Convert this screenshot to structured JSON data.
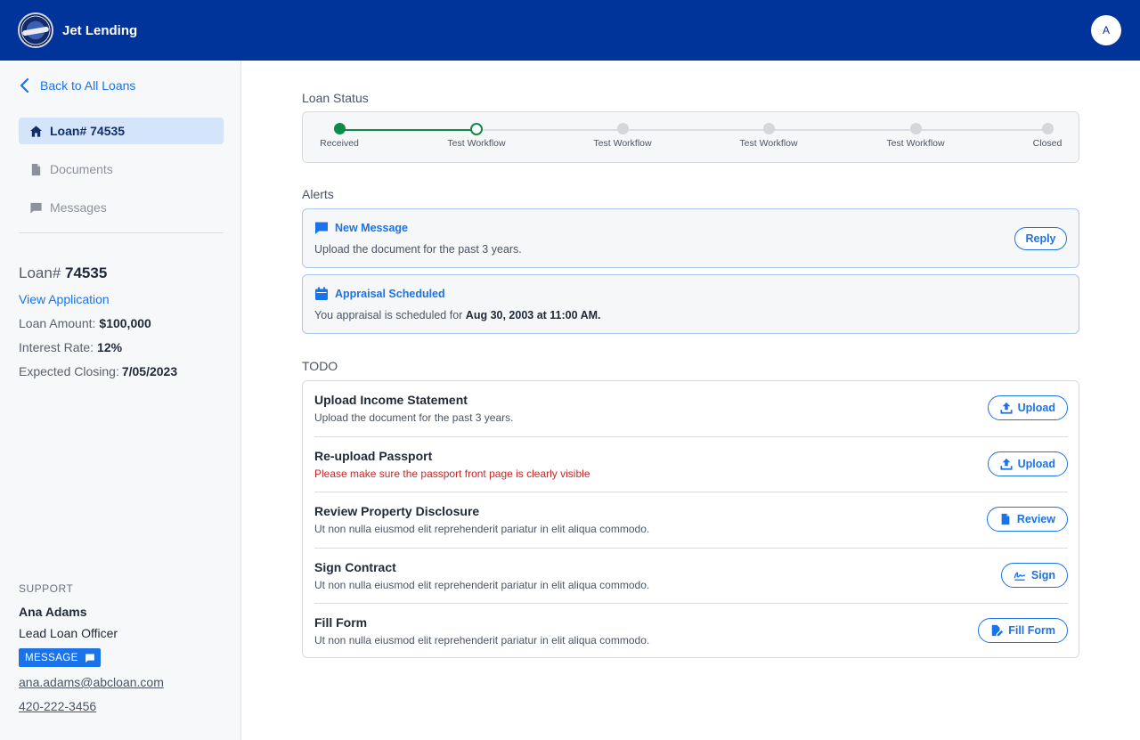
{
  "header": {
    "brand": "Jet Lending",
    "avatar_initial": "A"
  },
  "sidebar": {
    "back_label": "Back to All Loans",
    "nav": [
      {
        "label": "Loan# 74535",
        "icon": "home-icon",
        "active": true
      },
      {
        "label": "Documents",
        "icon": "document-icon",
        "active": false
      },
      {
        "label": "Messages",
        "icon": "chat-icon",
        "active": false
      }
    ],
    "loan": {
      "prefix": "Loan#",
      "number": "74535",
      "view_application": "View Application",
      "amount_label": "Loan Amount:",
      "amount": "$100,000",
      "rate_label": "Interest Rate:",
      "rate": "12%",
      "closing_label": "Expected Closing:",
      "closing": "7/05/2023"
    },
    "support": {
      "label": "SUPPORT",
      "name": "Ana Adams",
      "title": "Lead Loan Officer",
      "message_button": "MESSAGE",
      "email": "ana.adams@abcloan.com",
      "phone": "420-222-3456"
    }
  },
  "loan_status": {
    "title": "Loan Status",
    "steps": [
      {
        "label": "Received",
        "state": "done"
      },
      {
        "label": "Test Workflow",
        "state": "current"
      },
      {
        "label": "Test Workflow",
        "state": "pending"
      },
      {
        "label": "Test Workflow",
        "state": "pending"
      },
      {
        "label": "Test Workflow",
        "state": "pending"
      },
      {
        "label": "Closed",
        "state": "pending"
      }
    ],
    "colors": {
      "done": "#0e8b47",
      "pending": "#d5d7da"
    }
  },
  "alerts": {
    "title": "Alerts",
    "items": [
      {
        "icon": "chat-icon",
        "title": "New Message",
        "body": "Upload the document for the past 3 years.",
        "button": "Reply"
      },
      {
        "icon": "calendar-icon",
        "title": "Appraisal Scheduled",
        "body_prefix": "You appraisal is scheduled for ",
        "body_bold": "Aug 30, 2003 at 11:00 AM."
      }
    ]
  },
  "todo": {
    "title": "TODO",
    "items": [
      {
        "title": "Upload Income Statement",
        "desc": "Upload the document for the past 3 years.",
        "button": "Upload",
        "icon": "upload-icon",
        "warn": false
      },
      {
        "title": "Re-upload Passport",
        "desc": "Please make sure the passport front page is clearly visible",
        "button": "Upload",
        "icon": "upload-icon",
        "warn": true
      },
      {
        "title": "Review Property Disclosure",
        "desc": "Ut non nulla eiusmod elit reprehenderit pariatur in elit aliqua commodo.",
        "button": "Review",
        "icon": "document-icon",
        "warn": false
      },
      {
        "title": "Sign Contract",
        "desc": "Ut non nulla eiusmod elit reprehenderit pariatur in elit aliqua commodo.",
        "button": "Sign",
        "icon": "signature-icon",
        "warn": false
      },
      {
        "title": "Fill Form",
        "desc": "Ut non nulla eiusmod elit reprehenderit pariatur in elit aliqua commodo.",
        "button": "Fill Form",
        "icon": "edit-document-icon",
        "warn": false
      }
    ]
  }
}
